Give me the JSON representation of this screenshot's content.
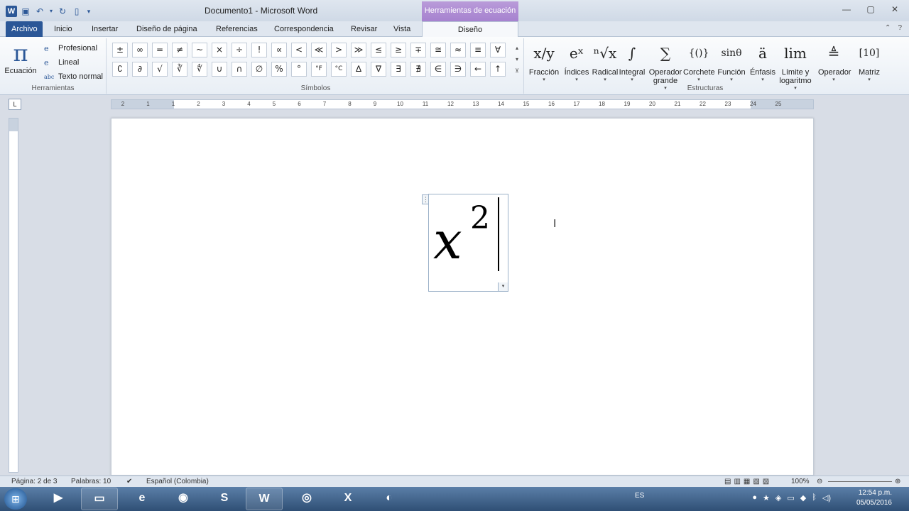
{
  "window": {
    "title": "Documento1 - Microsoft Word",
    "context_tab_header": "Herramientas de ecuación"
  },
  "tabs": [
    "Archivo",
    "Inicio",
    "Insertar",
    "Diseño de página",
    "Referencias",
    "Correspondencia",
    "Revisar",
    "Vista",
    "Diseño"
  ],
  "ribbon": {
    "herramientas": {
      "label": "Herramientas",
      "ecuacion_label": "Ecuación",
      "items": [
        {
          "label": "Profesional",
          "icon": "e-professional-icon"
        },
        {
          "label": "Lineal",
          "icon": "e-linear-icon"
        },
        {
          "label": "Texto normal",
          "icon": "abc-icon"
        }
      ]
    },
    "simbolos": {
      "label": "Símbolos",
      "row1": [
        "±",
        "∞",
        "=",
        "≠",
        "~",
        "×",
        "÷",
        "!",
        "∝",
        "<",
        "≪",
        ">",
        "≫",
        "≤",
        "≥",
        "∓",
        "≅",
        "≈",
        "≡",
        "∀"
      ],
      "row2": [
        "∁",
        "∂",
        "√",
        "∛",
        "∜",
        "∪",
        "∩",
        "∅",
        "%",
        "°",
        "°F",
        "°C",
        "∆",
        "∇",
        "∃",
        "∄",
        "∈",
        "∋",
        "←",
        "↑"
      ]
    },
    "estructuras": {
      "label": "Estructuras",
      "items": [
        {
          "glyph": "x/y",
          "label": "Fracción"
        },
        {
          "glyph": "eˣ",
          "label": "Índices"
        },
        {
          "glyph": "ⁿ√x",
          "label": "Radical"
        },
        {
          "glyph": "∫",
          "label": "Integral"
        },
        {
          "glyph": "∑",
          "label": "Operador grande"
        },
        {
          "glyph": "{()}",
          "label": "Corchete"
        },
        {
          "glyph": "sinθ",
          "label": "Función"
        },
        {
          "glyph": "ä",
          "label": "Énfasis"
        },
        {
          "glyph": "lim",
          "label": "Límite y logaritmo"
        },
        {
          "glyph": "≜",
          "label": "Operador"
        },
        {
          "glyph": "[10]",
          "label": "Matriz"
        }
      ]
    }
  },
  "ruler": {
    "numbers": [
      "2",
      "1",
      "1",
      "2",
      "3",
      "4",
      "5",
      "6",
      "7",
      "8",
      "9",
      "10",
      "11",
      "12",
      "13",
      "14",
      "15",
      "16",
      "17",
      "18",
      "19",
      "20",
      "21",
      "22",
      "23",
      "24",
      "25"
    ]
  },
  "equation": {
    "base": "x",
    "superscript": "2"
  },
  "statusbar": {
    "page": "Página: 2 de 3",
    "words": "Palabras: 10",
    "language": "Español (Colombia)",
    "zoom": "100%"
  },
  "taskbar": {
    "language": "ES",
    "time": "12:54 p.m.",
    "date": "05/05/2016"
  }
}
